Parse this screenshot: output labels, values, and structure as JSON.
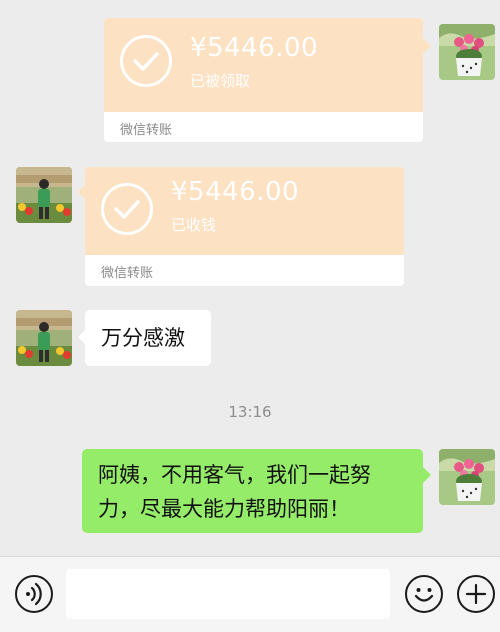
{
  "messages": {
    "transfer_sent": {
      "amount": "¥5446.00",
      "status": "已被领取",
      "footer": "微信转账"
    },
    "transfer_received": {
      "amount": "¥5446.00",
      "status": "已收钱",
      "footer": "微信转账"
    },
    "thanks": {
      "text": "万分感激"
    },
    "timestamp": "13:16",
    "reply": {
      "line1": "阿姨，不用客气，我们一起努",
      "line2": "力，尽最大能力帮助阳丽！"
    }
  },
  "input_bar": {
    "voice_icon": "voice-icon",
    "emoji_icon": "emoji-icon",
    "plus_icon": "plus-icon",
    "message_value": ""
  },
  "colors": {
    "chat_background": "#ececec",
    "transfer_card": "#fde1c3",
    "sent_bubble": "#95ec69",
    "received_bubble": "#ffffff"
  }
}
